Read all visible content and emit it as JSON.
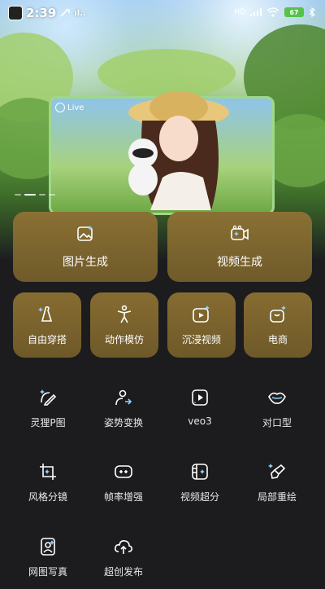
{
  "status_bar": {
    "time": "2:39",
    "signal": "HD",
    "battery": "67"
  },
  "hero": {
    "live_label": "Live"
  },
  "big_cards": [
    {
      "label": "图片生成",
      "icon": "image-sparkle-icon"
    },
    {
      "label": "视频生成",
      "icon": "video-sparkle-icon"
    }
  ],
  "small_cards": [
    {
      "label": "自由穿搭",
      "icon": "hanger-sparkle-icon"
    },
    {
      "label": "动作模仿",
      "icon": "person-pose-icon"
    },
    {
      "label": "沉浸视频",
      "icon": "play-sparkle-icon"
    },
    {
      "label": "电商",
      "icon": "bag-sparkle-icon"
    }
  ],
  "tools": [
    {
      "label": "灵狸P图",
      "icon": "edit-sparkle-icon"
    },
    {
      "label": "姿势变换",
      "icon": "person-swap-icon"
    },
    {
      "label": "veo3",
      "icon": "play-square-icon"
    },
    {
      "label": "对口型",
      "icon": "lips-icon"
    },
    {
      "label": "风格分镜",
      "icon": "crop-icon"
    },
    {
      "label": "帧率增强",
      "icon": "frame-rate-icon"
    },
    {
      "label": "视频超分",
      "icon": "film-upscale-icon"
    },
    {
      "label": "局部重绘",
      "icon": "brush-icon"
    },
    {
      "label": "网图写真",
      "icon": "portrait-icon"
    },
    {
      "label": "超创发布",
      "icon": "cloud-upload-icon"
    }
  ],
  "accent_color": "#7a6330",
  "sparkle_color": "#8fd3ff"
}
